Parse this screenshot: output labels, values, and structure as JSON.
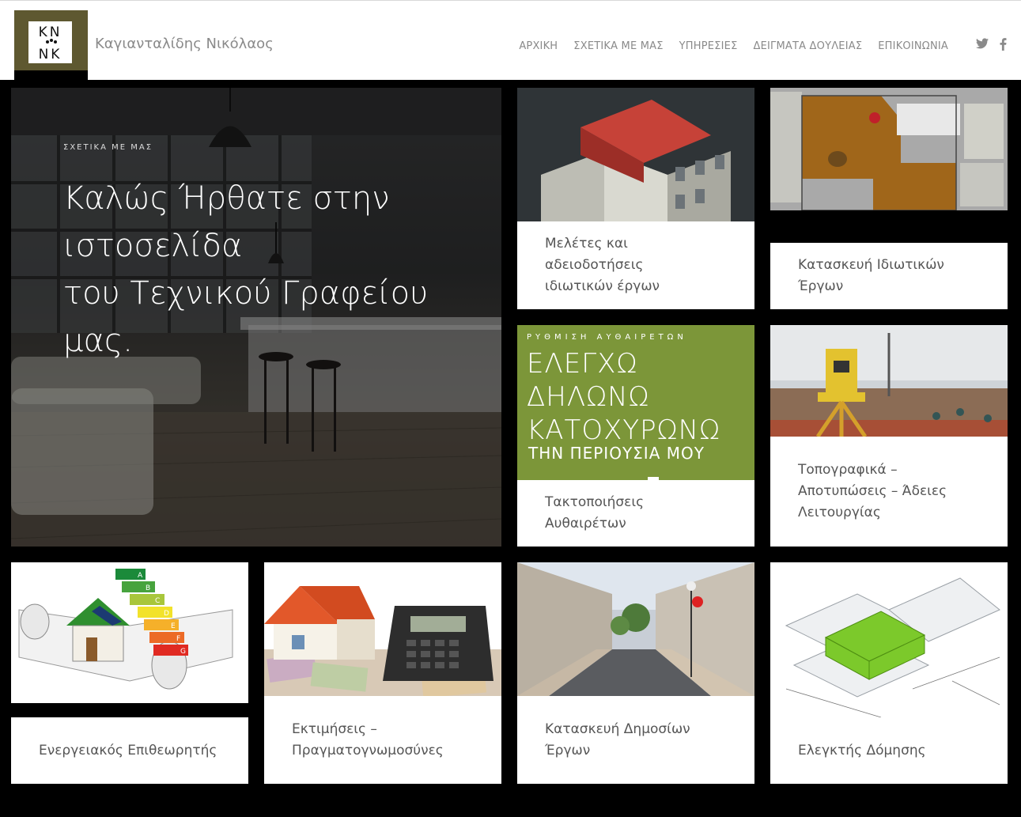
{
  "brand": {
    "logo_line1": "KN",
    "logo_line2": "NK",
    "site_name": "Καγιανταλίδης Νικόλαος"
  },
  "nav": {
    "items": [
      "ΑΡΧΙΚΗ",
      "ΣΧΕΤΙΚΑ ΜΕ ΜΑΣ",
      "ΥΠΗΡΕΣΙΕΣ",
      "ΔΕΙΓΜΑΤΑ ΔΟΥΛΕΙΑΣ",
      "ΕΠΙΚΟΙΝΩΝΙΑ"
    ]
  },
  "social": {
    "icons": [
      "twitter-icon",
      "facebook-icon"
    ]
  },
  "hero": {
    "kicker": "ΣΧΕΤΙΚΑ ΜΕ ΜΑΣ",
    "title_lines": [
      "Καλώς Ήρθατε στην",
      "ιστοσελίδα",
      "του Τεχνικού Γραφείου",
      "μας."
    ]
  },
  "banner": {
    "top": "ΡΥΘΜΙΣΗ ΑΥΘΑΙΡΕΤΩΝ",
    "lines": [
      "ΕΛΕΓΧΩ",
      "ΔΗΛΩΝΩ",
      "ΚΑΤΟΧΥΡΩΝΩ",
      "ΤΗΝ ΠΕΡΙΟΥΣΙΑ ΜΟΥ"
    ]
  },
  "cards": {
    "studies": [
      "Μελέτες και αδειοδοτήσεις",
      "ιδιωτικών έργων"
    ],
    "private": [
      "Κατασκευή Ιδιωτικών Έργων"
    ],
    "regularize": [
      "Τακτοποιήσεις Αυθαιρέτων"
    ],
    "topo": [
      "Τοπογραφικά –",
      "Αποτυπώσεις – Άδειες",
      "Λειτουργίας"
    ],
    "energy": [
      "Ενεργειακός Επιθεωρητής"
    ],
    "valuation": [
      "Εκτιμήσεις –",
      "Πραγματογνωμοσύνες"
    ],
    "public": [
      "Κατασκευή Δημοσίων",
      "Έργων"
    ],
    "inspector": [
      "Ελεγκτής Δόμησης"
    ]
  },
  "energy_labels": [
    "A",
    "B",
    "C",
    "D",
    "E",
    "F",
    "G"
  ],
  "colors": {
    "logo_olive": "#5e5830",
    "banner_green": "#7c9639",
    "nav_text": "#8a8a8a",
    "label_text": "#555555"
  }
}
